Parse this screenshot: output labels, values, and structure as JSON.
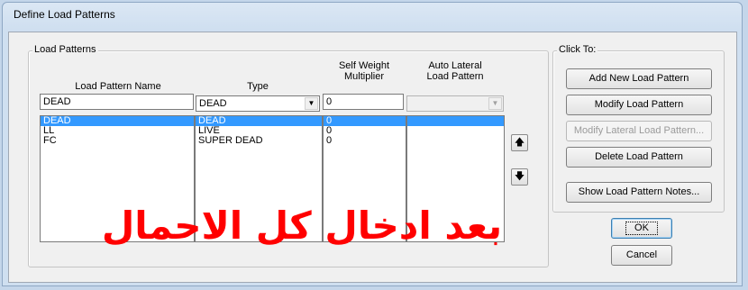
{
  "window": {
    "title": "Define Load Patterns"
  },
  "load_patterns": {
    "legend": "Load Patterns",
    "headers": {
      "name": "Load Pattern Name",
      "type": "Type",
      "self_weight_line1": "Self Weight",
      "self_weight_line2": "Multiplier",
      "auto_lateral_line1": "Auto Lateral",
      "auto_lateral_line2": "Load Pattern"
    },
    "inputs": {
      "name": "DEAD",
      "type": "DEAD",
      "self_weight": "0",
      "auto_lateral": ""
    },
    "rows": [
      {
        "name": "DEAD",
        "type": "DEAD",
        "multiplier": "0",
        "auto_lateral": ""
      },
      {
        "name": "LL",
        "type": "LIVE",
        "multiplier": "0",
        "auto_lateral": ""
      },
      {
        "name": "FC",
        "type": "SUPER DEAD",
        "multiplier": "0",
        "auto_lateral": ""
      }
    ],
    "selected_index": 0
  },
  "click_to": {
    "legend": "Click To:",
    "add": "Add New Load Pattern",
    "modify": "Modify Load Pattern",
    "modify_lateral": "Modify Lateral Load Pattern...",
    "delete": "Delete Load Pattern",
    "notes": "Show Load Pattern Notes..."
  },
  "buttons": {
    "ok": "OK",
    "cancel": "Cancel"
  },
  "overlay": {
    "text": "بعد ادخال كل الاحمال"
  },
  "icons": {
    "move_up": "up-arrow-icon",
    "move_down": "down-arrow-icon",
    "dropdown": "chevron-down-icon"
  }
}
